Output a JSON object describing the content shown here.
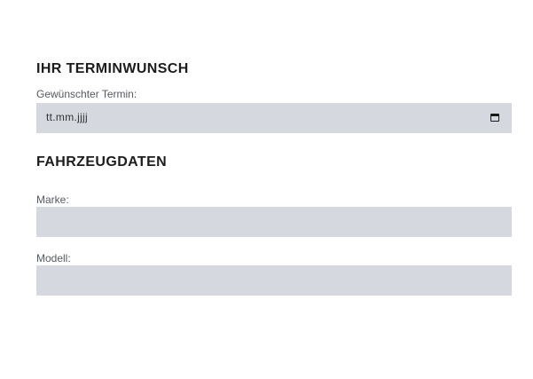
{
  "appointment": {
    "section_title": "IHR TERMINWUNSCH",
    "date_label": "Gewünschter Termin:",
    "date_placeholder": "tt.mm.jjjj",
    "calendar_icon": "calendar-icon"
  },
  "vehicle": {
    "section_title": "FAHRZEUGDATEN",
    "brand_label": "Marke:",
    "brand_value": "",
    "model_label": "Modell:",
    "model_value": ""
  },
  "colors": {
    "field_background": "#d5d8de",
    "heading_text": "#1c1c1c",
    "label_text": "#555a60"
  }
}
